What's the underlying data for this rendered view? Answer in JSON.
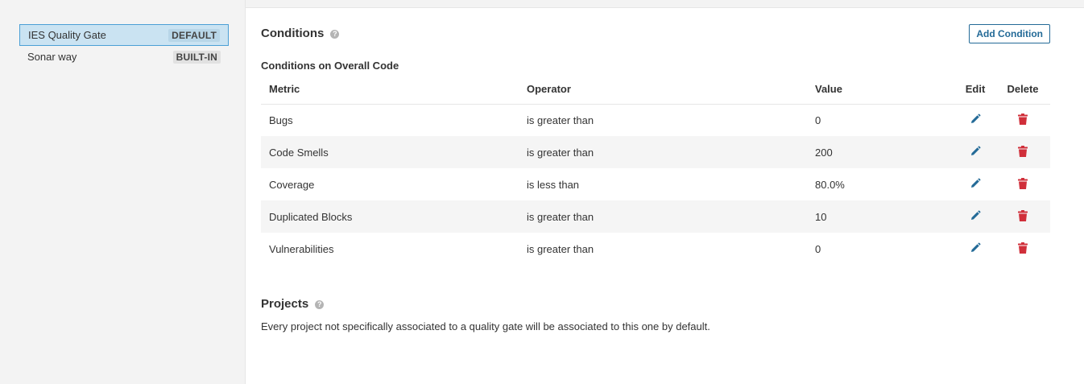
{
  "sidebar": {
    "gates": [
      {
        "name": "IES Quality Gate",
        "badge": "DEFAULT"
      },
      {
        "name": "Sonar way",
        "badge": "BUILT-IN"
      }
    ]
  },
  "conditions": {
    "title": "Conditions",
    "add_label": "Add Condition",
    "subtitle": "Conditions on Overall Code",
    "headers": {
      "metric": "Metric",
      "operator": "Operator",
      "value": "Value",
      "edit": "Edit",
      "delete": "Delete"
    },
    "rows": [
      {
        "metric": "Bugs",
        "operator": "is greater than",
        "value": "0"
      },
      {
        "metric": "Code Smells",
        "operator": "is greater than",
        "value": "200"
      },
      {
        "metric": "Coverage",
        "operator": "is less than",
        "value": "80.0%"
      },
      {
        "metric": "Duplicated Blocks",
        "operator": "is greater than",
        "value": "10"
      },
      {
        "metric": "Vulnerabilities",
        "operator": "is greater than",
        "value": "0"
      }
    ]
  },
  "projects": {
    "title": "Projects",
    "description": "Every project not specifically associated to a quality gate will be associated to this one by default."
  },
  "colors": {
    "accent": "#236a97",
    "delete": "#d02f3a",
    "selected_bg": "#cae3f2"
  }
}
